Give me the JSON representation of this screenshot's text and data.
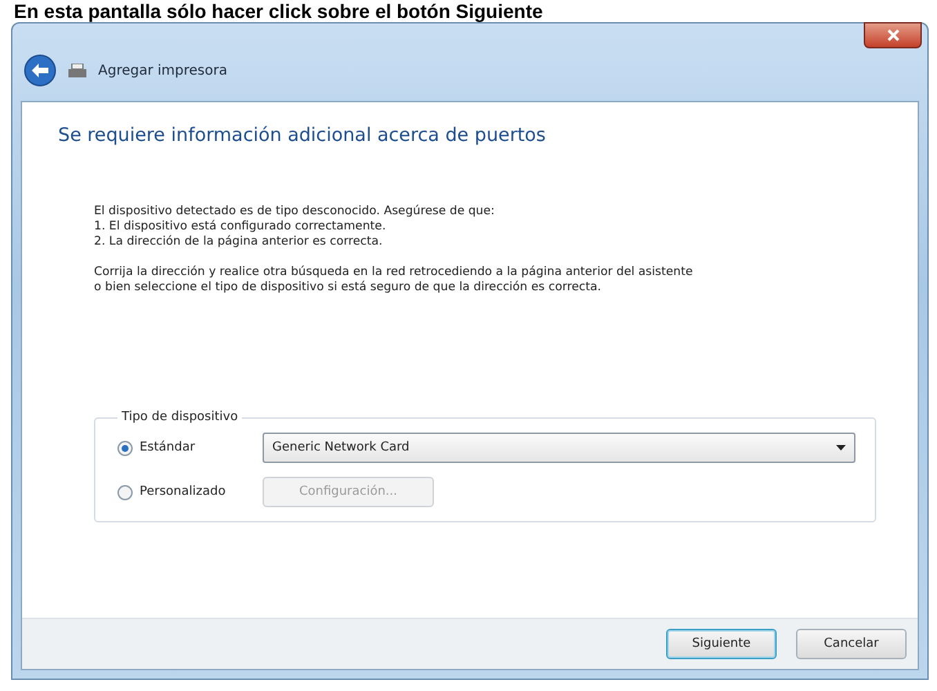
{
  "caption": "En esta pantalla sólo hacer click sobre el botón Siguiente",
  "window": {
    "title": "Agregar impresora"
  },
  "heading": "Se requiere información adicional acerca de puertos",
  "paragraphs": [
    [
      "El dispositivo detectado es de tipo desconocido.  Asegúrese de que:",
      "1. El dispositivo está configurado correctamente.",
      "2. La dirección de la página anterior es correcta."
    ],
    [
      "Corrija la dirección y realice otra búsqueda en la red retrocediendo a la página anterior del asistente",
      "o bien seleccione el tipo de dispositivo si está seguro de que la dirección es correcta."
    ]
  ],
  "device_type": {
    "label": "Tipo de dispositivo",
    "options": [
      {
        "label": "Estándar",
        "selected": true,
        "kind": "dropdown",
        "value": "Generic Network Card"
      },
      {
        "label": "Personalizado",
        "selected": false,
        "kind": "button",
        "button": {
          "label": "Configuración...",
          "disabled": true
        }
      }
    ]
  },
  "buttons": [
    {
      "label": "Siguiente",
      "default": true
    },
    {
      "label": "Cancelar",
      "default": false
    }
  ]
}
